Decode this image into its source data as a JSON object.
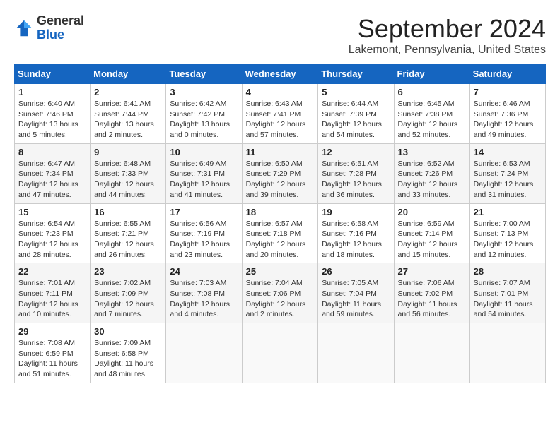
{
  "header": {
    "logo": {
      "general": "General",
      "blue": "Blue"
    },
    "month": "September 2024",
    "location": "Lakemont, Pennsylvania, United States"
  },
  "weekdays": [
    "Sunday",
    "Monday",
    "Tuesday",
    "Wednesday",
    "Thursday",
    "Friday",
    "Saturday"
  ],
  "weeks": [
    [
      {
        "day": "1",
        "sunrise": "6:40 AM",
        "sunset": "7:46 PM",
        "daylight": "13 hours and 5 minutes."
      },
      {
        "day": "2",
        "sunrise": "6:41 AM",
        "sunset": "7:44 PM",
        "daylight": "13 hours and 2 minutes."
      },
      {
        "day": "3",
        "sunrise": "6:42 AM",
        "sunset": "7:42 PM",
        "daylight": "13 hours and 0 minutes."
      },
      {
        "day": "4",
        "sunrise": "6:43 AM",
        "sunset": "7:41 PM",
        "daylight": "12 hours and 57 minutes."
      },
      {
        "day": "5",
        "sunrise": "6:44 AM",
        "sunset": "7:39 PM",
        "daylight": "12 hours and 54 minutes."
      },
      {
        "day": "6",
        "sunrise": "6:45 AM",
        "sunset": "7:38 PM",
        "daylight": "12 hours and 52 minutes."
      },
      {
        "day": "7",
        "sunrise": "6:46 AM",
        "sunset": "7:36 PM",
        "daylight": "12 hours and 49 minutes."
      }
    ],
    [
      {
        "day": "8",
        "sunrise": "6:47 AM",
        "sunset": "7:34 PM",
        "daylight": "12 hours and 47 minutes."
      },
      {
        "day": "9",
        "sunrise": "6:48 AM",
        "sunset": "7:33 PM",
        "daylight": "12 hours and 44 minutes."
      },
      {
        "day": "10",
        "sunrise": "6:49 AM",
        "sunset": "7:31 PM",
        "daylight": "12 hours and 41 minutes."
      },
      {
        "day": "11",
        "sunrise": "6:50 AM",
        "sunset": "7:29 PM",
        "daylight": "12 hours and 39 minutes."
      },
      {
        "day": "12",
        "sunrise": "6:51 AM",
        "sunset": "7:28 PM",
        "daylight": "12 hours and 36 minutes."
      },
      {
        "day": "13",
        "sunrise": "6:52 AM",
        "sunset": "7:26 PM",
        "daylight": "12 hours and 33 minutes."
      },
      {
        "day": "14",
        "sunrise": "6:53 AM",
        "sunset": "7:24 PM",
        "daylight": "12 hours and 31 minutes."
      }
    ],
    [
      {
        "day": "15",
        "sunrise": "6:54 AM",
        "sunset": "7:23 PM",
        "daylight": "12 hours and 28 minutes."
      },
      {
        "day": "16",
        "sunrise": "6:55 AM",
        "sunset": "7:21 PM",
        "daylight": "12 hours and 26 minutes."
      },
      {
        "day": "17",
        "sunrise": "6:56 AM",
        "sunset": "7:19 PM",
        "daylight": "12 hours and 23 minutes."
      },
      {
        "day": "18",
        "sunrise": "6:57 AM",
        "sunset": "7:18 PM",
        "daylight": "12 hours and 20 minutes."
      },
      {
        "day": "19",
        "sunrise": "6:58 AM",
        "sunset": "7:16 PM",
        "daylight": "12 hours and 18 minutes."
      },
      {
        "day": "20",
        "sunrise": "6:59 AM",
        "sunset": "7:14 PM",
        "daylight": "12 hours and 15 minutes."
      },
      {
        "day": "21",
        "sunrise": "7:00 AM",
        "sunset": "7:13 PM",
        "daylight": "12 hours and 12 minutes."
      }
    ],
    [
      {
        "day": "22",
        "sunrise": "7:01 AM",
        "sunset": "7:11 PM",
        "daylight": "12 hours and 10 minutes."
      },
      {
        "day": "23",
        "sunrise": "7:02 AM",
        "sunset": "7:09 PM",
        "daylight": "12 hours and 7 minutes."
      },
      {
        "day": "24",
        "sunrise": "7:03 AM",
        "sunset": "7:08 PM",
        "daylight": "12 hours and 4 minutes."
      },
      {
        "day": "25",
        "sunrise": "7:04 AM",
        "sunset": "7:06 PM",
        "daylight": "12 hours and 2 minutes."
      },
      {
        "day": "26",
        "sunrise": "7:05 AM",
        "sunset": "7:04 PM",
        "daylight": "11 hours and 59 minutes."
      },
      {
        "day": "27",
        "sunrise": "7:06 AM",
        "sunset": "7:02 PM",
        "daylight": "11 hours and 56 minutes."
      },
      {
        "day": "28",
        "sunrise": "7:07 AM",
        "sunset": "7:01 PM",
        "daylight": "11 hours and 54 minutes."
      }
    ],
    [
      {
        "day": "29",
        "sunrise": "7:08 AM",
        "sunset": "6:59 PM",
        "daylight": "11 hours and 51 minutes."
      },
      {
        "day": "30",
        "sunrise": "7:09 AM",
        "sunset": "6:58 PM",
        "daylight": "11 hours and 48 minutes."
      },
      null,
      null,
      null,
      null,
      null
    ]
  ],
  "labels": {
    "sunrise": "Sunrise:",
    "sunset": "Sunset:",
    "daylight": "Daylight:"
  }
}
